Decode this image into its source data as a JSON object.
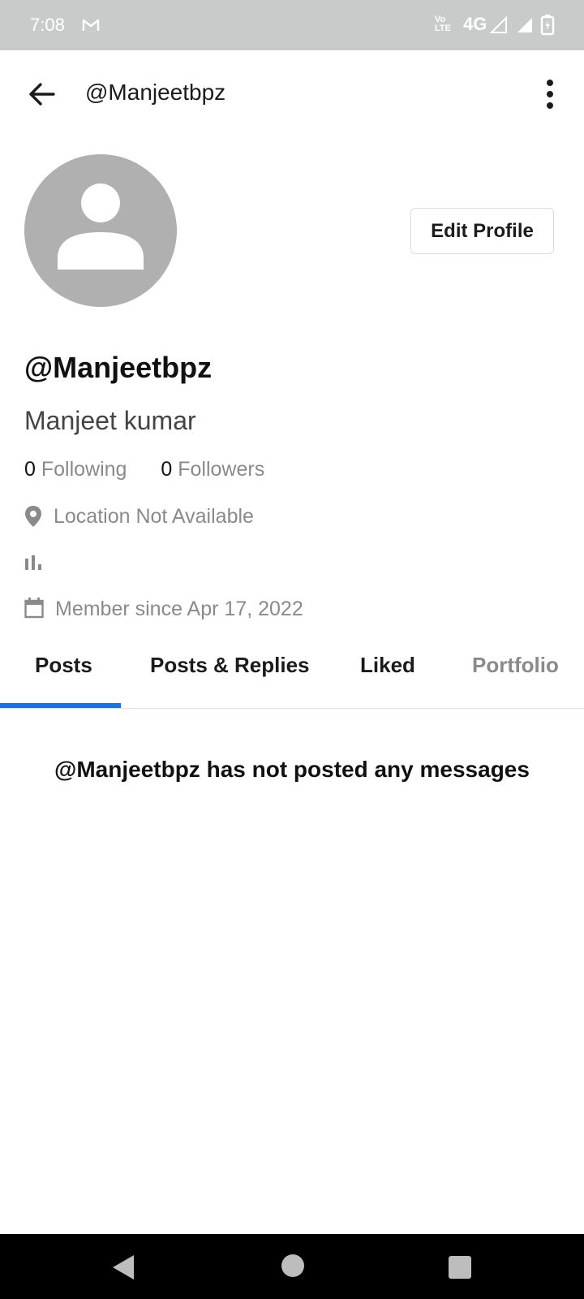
{
  "status_bar": {
    "time": "7:08",
    "network": "4G",
    "volte": "VoLTE2"
  },
  "app_bar": {
    "title": "@Manjeetbpz"
  },
  "profile": {
    "edit_button": "Edit Profile",
    "handle": "@Manjeetbpz",
    "full_name": "Manjeet kumar",
    "following_count": "0",
    "following_label": "Following",
    "followers_count": "0",
    "followers_label": "Followers",
    "location": "Location Not Available",
    "member_since": "Member since Apr 17, 2022"
  },
  "tabs": [
    {
      "label": "Posts",
      "active": true
    },
    {
      "label": "Posts & Replies",
      "active": false
    },
    {
      "label": "Liked",
      "active": false
    },
    {
      "label": "Portfolio",
      "active": false
    }
  ],
  "empty_state": "@Manjeetbpz has not posted any messages",
  "colors": {
    "accent": "#1a73d9",
    "status_bar_bg": "#c9cbca",
    "muted_text": "#8a8a8a",
    "avatar_bg": "#b0b0b0"
  }
}
